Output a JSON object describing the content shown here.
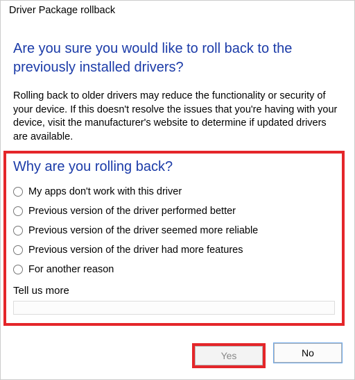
{
  "window": {
    "title": "Driver Package rollback"
  },
  "heading": "Are you sure you would like to roll back to the previously installed drivers?",
  "warning": "Rolling back to older drivers may reduce the functionality or security of your device. If this doesn't resolve the issues that you're having with your device, visit the manufacturer's website to determine if updated drivers are available.",
  "subhead": "Why are you rolling back?",
  "options": [
    "My apps don't work with this driver",
    "Previous version of the driver performed better",
    "Previous version of the driver seemed more reliable",
    "Previous version of the driver had more features",
    "For another reason"
  ],
  "tellus_label": "Tell us more",
  "tellus_value": "",
  "buttons": {
    "yes": "Yes",
    "no": "No"
  }
}
